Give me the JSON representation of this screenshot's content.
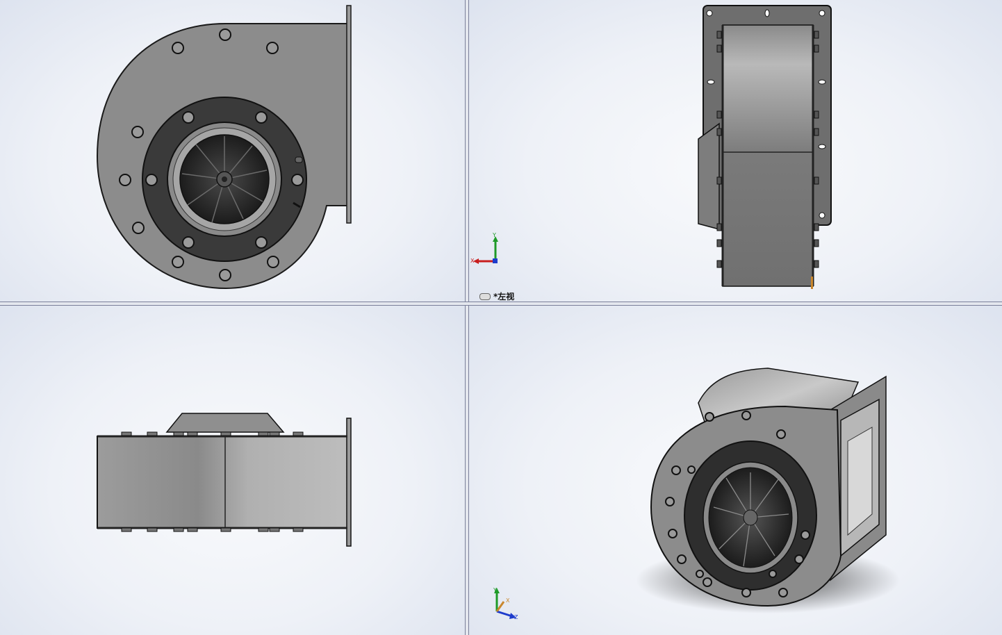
{
  "window": {
    "layout": "four-viewport",
    "colors": {
      "splitter": "#7a7f9a",
      "background": "#eef1f7",
      "part_fill": "#8c8c8c",
      "axis_x": "#c81e1e",
      "axis_y": "#1e9a28",
      "axis_z": "#1e3ccc"
    }
  },
  "viewports": {
    "top_right": {
      "view_label": "*左视",
      "view_icon": "view-orientation-icon"
    }
  },
  "triad": {
    "top_right": {
      "x": "X",
      "y": "Y",
      "z": "Z"
    },
    "bottom_right": {
      "x": "X",
      "y": "Y",
      "z": "Z"
    }
  }
}
